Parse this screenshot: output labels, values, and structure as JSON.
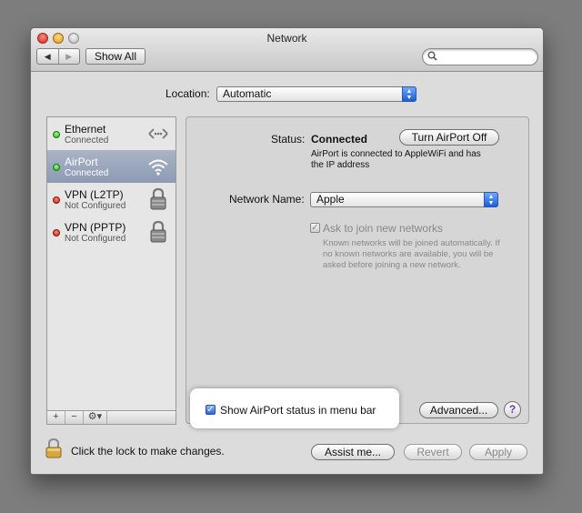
{
  "window": {
    "title": "Network"
  },
  "toolbar": {
    "show_all_label": "Show All",
    "search_placeholder": ""
  },
  "location": {
    "label": "Location:",
    "value": "Automatic"
  },
  "services": [
    {
      "name": "Ethernet",
      "status": "Connected",
      "status_color": "#25a31a",
      "icon": "ethernet-icon"
    },
    {
      "name": "AirPort",
      "status": "Connected",
      "status_color": "#25a31a",
      "icon": "wifi-icon",
      "selected": true
    },
    {
      "name": "VPN (L2TP)",
      "status": "Not Configured",
      "status_color": "#c8150b",
      "icon": "lock-icon"
    },
    {
      "name": "VPN (PPTP)",
      "status": "Not Configured",
      "status_color": "#c8150b",
      "icon": "lock-icon"
    }
  ],
  "sidebar_tools": {
    "add": "+",
    "remove": "−",
    "gear": "⚙▾"
  },
  "detail": {
    "status_label": "Status:",
    "status_value": "Connected",
    "turn_off_label": "Turn AirPort Off",
    "status_description": "AirPort is connected to AppleWiFi and has the IP address",
    "network_name_label": "Network Name:",
    "network_name_value": "Apple",
    "ask_join_label": "Ask to join new networks",
    "ask_join_checked": true,
    "ask_join_description": "Known networks will be joined automatically. If no known networks are available, you will be asked before joining a new network.",
    "show_status_label": "Show AirPort status in menu bar",
    "show_status_checked": true,
    "advanced_label": "Advanced...",
    "help_label": "?"
  },
  "footer": {
    "lock_text": "Click the lock to make changes.",
    "assist_label": "Assist me...",
    "revert_label": "Revert",
    "apply_label": "Apply"
  },
  "colors": {
    "selection": "#8d9ab2",
    "accent": "#2b67d9"
  }
}
